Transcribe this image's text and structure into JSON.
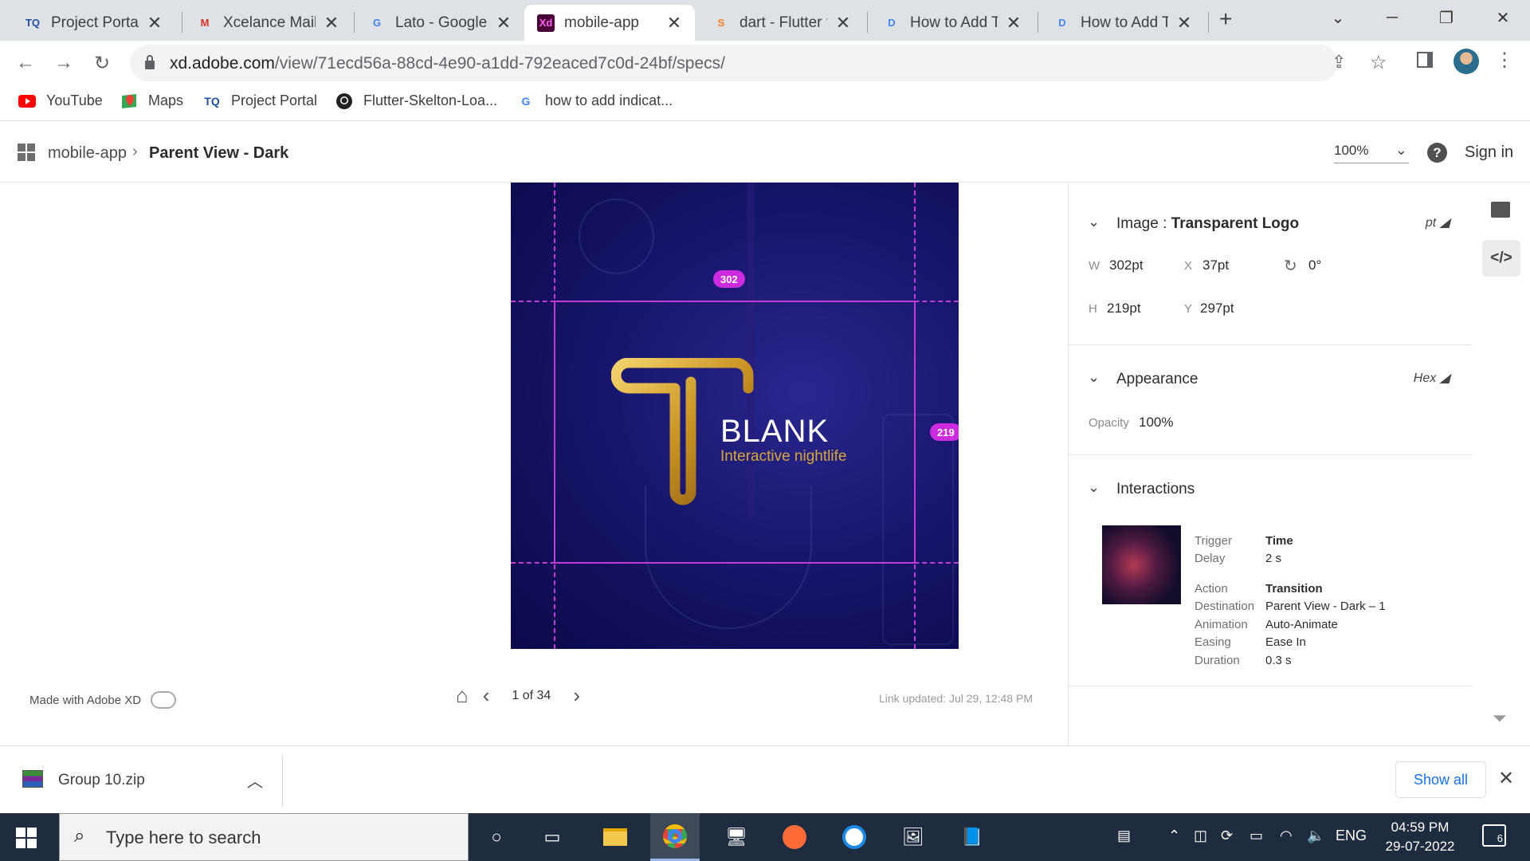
{
  "browser": {
    "tabs": [
      {
        "title": "Project Portal",
        "icon": "TQ",
        "icon_color": "#1f4fa0"
      },
      {
        "title": "Xcelance Mail",
        "icon": "M",
        "icon_color": "#d93025"
      },
      {
        "title": "Lato - Google F",
        "icon": "G",
        "icon_color": "#4285f4"
      },
      {
        "title": "mobile-app",
        "icon": "Xd",
        "icon_color": "#470137"
      },
      {
        "title": "dart - Flutter te",
        "icon": "S",
        "icon_color": "#f48024"
      },
      {
        "title": "How to Add Tr",
        "icon": "D",
        "icon_color": "#4285f4"
      },
      {
        "title": "How to Add Tr",
        "icon": "D",
        "icon_color": "#4285f4"
      }
    ],
    "new_tab": "+",
    "url_host": "xd.adobe.com",
    "url_path": "/view/71ecd56a-88cd-4e90-a1dd-792eaced7c0d-24bf/specs/",
    "bookmarks": [
      {
        "label": "YouTube",
        "icon": "youtube-icon"
      },
      {
        "label": "Maps",
        "icon": "maps-icon"
      },
      {
        "label": "Project Portal",
        "icon": "TQ"
      },
      {
        "label": "Flutter-Skelton-Loa...",
        "icon": "github-icon"
      },
      {
        "label": "how to add indicat...",
        "icon": "G"
      }
    ]
  },
  "xd": {
    "project": "mobile-app",
    "page": "Parent View - Dark",
    "zoom": "100%",
    "help": "?",
    "signin": "Sign in",
    "artboard": {
      "width_badge": "302",
      "height_badge": "219",
      "brand": "BLANK",
      "tagline": "Interactive nightlife"
    },
    "made_with": "Made with Adobe XD",
    "page_count": "1 of 34",
    "link_updated": "Link updated: Jul 29, 12:48 PM"
  },
  "inspector": {
    "image": {
      "label": "Image :",
      "name": "Transparent Logo",
      "unit": "pt",
      "w_label": "W",
      "w": "302pt",
      "x_label": "X",
      "x": "37pt",
      "rot": "0°",
      "h_label": "H",
      "h": "219pt",
      "y_label": "Y",
      "y": "297pt"
    },
    "appearance": {
      "title": "Appearance",
      "unit": "Hex",
      "opacity_label": "Opacity",
      "opacity": "100%"
    },
    "interactions": {
      "title": "Interactions",
      "rows": [
        {
          "label": "Trigger",
          "value": "Time",
          "bold": true
        },
        {
          "label": "Delay",
          "value": "2 s",
          "bold": false
        },
        {
          "label": "Action",
          "value": "Transition",
          "bold": true
        },
        {
          "label": "Destination",
          "value": "Parent View - Dark – 1",
          "bold": false
        },
        {
          "label": "Animation",
          "value": "Auto-Animate",
          "bold": false
        },
        {
          "label": "Easing",
          "value": "Ease In",
          "bold": false
        },
        {
          "label": "Duration",
          "value": "0.3 s",
          "bold": false
        }
      ]
    }
  },
  "downloads": {
    "file": "Group 10.zip",
    "show_all": "Show all"
  },
  "taskbar": {
    "search_placeholder": "Type here to search",
    "lang": "ENG",
    "time": "04:59 PM",
    "date": "29-07-2022",
    "notifications": "6"
  }
}
